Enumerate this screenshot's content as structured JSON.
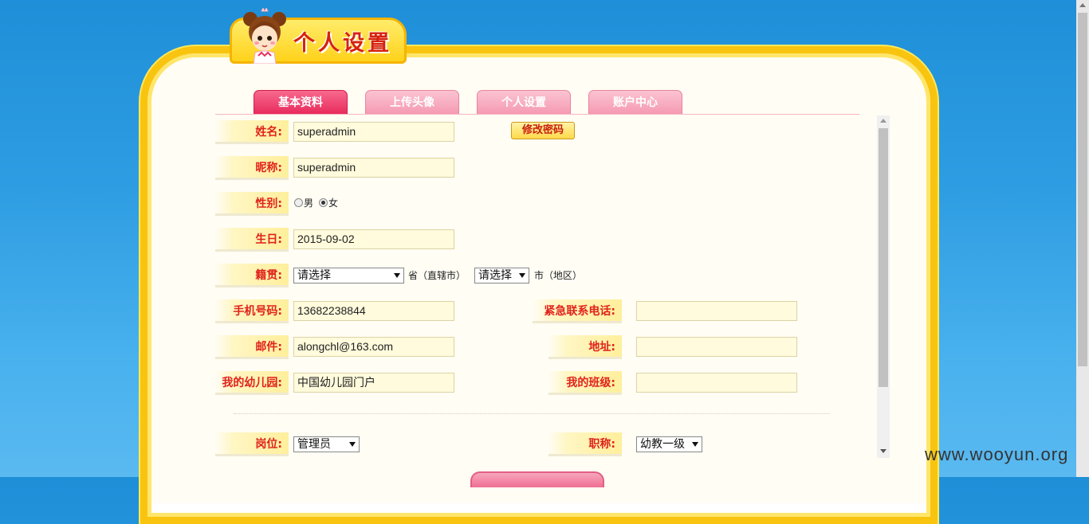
{
  "header": {
    "title": "个人设置"
  },
  "tabs": [
    {
      "label": "基本资料",
      "active": true
    },
    {
      "label": "上传头像",
      "active": false
    },
    {
      "label": "个人设置",
      "active": false
    },
    {
      "label": "账户中心",
      "active": false
    }
  ],
  "form": {
    "name": {
      "label": "姓名:",
      "value": "superadmin"
    },
    "change_password": "修改密码",
    "nickname": {
      "label": "昵称:",
      "value": "superadmin"
    },
    "gender": {
      "label": "性别:",
      "male": "男",
      "female": "女",
      "selected": "女"
    },
    "birthday": {
      "label": "生日:",
      "value": "2015-09-02"
    },
    "origin": {
      "label": "籍贯:",
      "province": "请选择",
      "province_suffix": "省（直辖市）",
      "city": "请选择",
      "city_suffix": "市（地区）"
    },
    "phone": {
      "label": "手机号码:",
      "value": "13682238844"
    },
    "emergency_phone": {
      "label": "紧急联系电话:",
      "value": ""
    },
    "email": {
      "label": "邮件:",
      "value": "alongchl@163.com"
    },
    "address": {
      "label": "地址:",
      "value": ""
    },
    "kindergarten": {
      "label": "我的幼儿园:",
      "value": "中国幼儿园门户"
    },
    "class": {
      "label": "我的班级:",
      "value": ""
    },
    "position": {
      "label": "岗位:",
      "value": "管理员"
    },
    "title": {
      "label": "职称:",
      "value": "幼教一级"
    }
  },
  "watermark": "www.wooyun.org",
  "colors": {
    "accent": "#e82b5c",
    "label_text": "#e0221a",
    "frame": "#f9c40f",
    "background": "#2f9de2"
  }
}
